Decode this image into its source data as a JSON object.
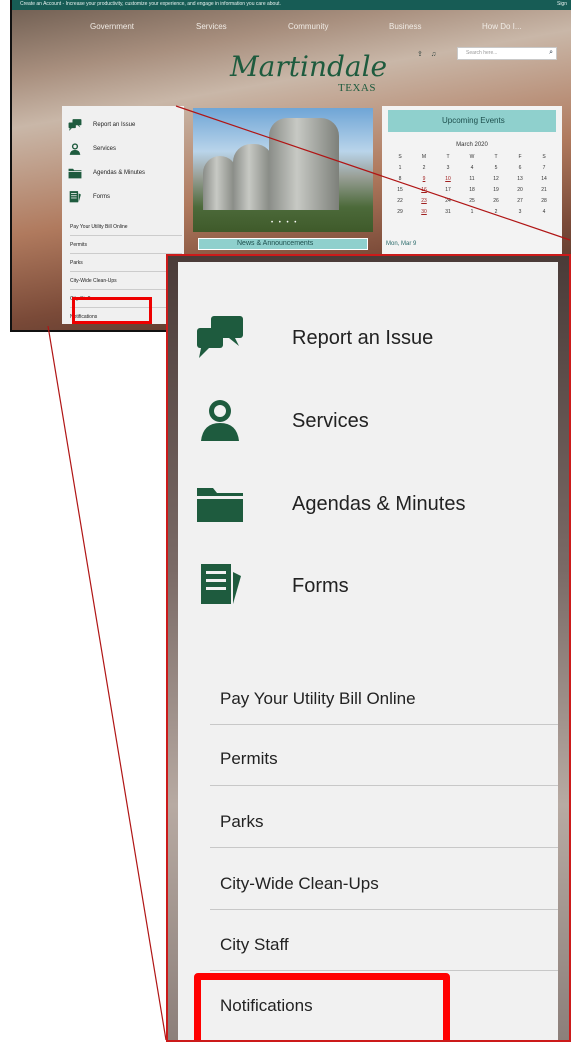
{
  "topbar": {
    "message": "Create an Account - Increase your productivity, customize your experience, and engage in information you care about.",
    "sign_in": "Sign"
  },
  "nav": {
    "items": [
      "Government",
      "Services",
      "Community",
      "Business",
      "How Do I..."
    ]
  },
  "brand": {
    "name": "Martindale",
    "state": "TEXAS"
  },
  "search": {
    "placeholder": "Search here..."
  },
  "sidebar": {
    "icon_items": [
      {
        "label": "Report an Issue",
        "icon": "chat-bubbles-icon"
      },
      {
        "label": "Services",
        "icon": "person-icon"
      },
      {
        "label": "Agendas & Minutes",
        "icon": "folder-icon"
      },
      {
        "label": "Forms",
        "icon": "document-icon"
      }
    ],
    "links": [
      "Pay Your Utility Bill Online",
      "Permits",
      "Parks",
      "City-Wide Clean-Ups",
      "City Staff",
      "Notifications"
    ]
  },
  "slider": {
    "dots": "• • • •"
  },
  "news": {
    "heading": "News & Announcements"
  },
  "events": {
    "heading": "Upcoming Events",
    "month": "March 2020",
    "weekdays": [
      "S",
      "M",
      "T",
      "W",
      "T",
      "F",
      "S"
    ],
    "weeks": [
      [
        "1",
        "2",
        "3",
        "4",
        "5",
        "6",
        "7"
      ],
      [
        "8",
        "9",
        "10",
        "11",
        "12",
        "13",
        "14"
      ],
      [
        "15",
        "16",
        "17",
        "18",
        "19",
        "20",
        "21"
      ],
      [
        "22",
        "23",
        "24",
        "25",
        "26",
        "27",
        "28"
      ],
      [
        "29",
        "30",
        "31",
        "1",
        "2",
        "3",
        "4"
      ]
    ],
    "first_event_date": "Mon, Mar 9"
  },
  "colors": {
    "accent_green": "#175c55",
    "icon_green": "#1e5b3e",
    "highlight_red": "#ee0000",
    "teal": "#8fd0cd"
  }
}
